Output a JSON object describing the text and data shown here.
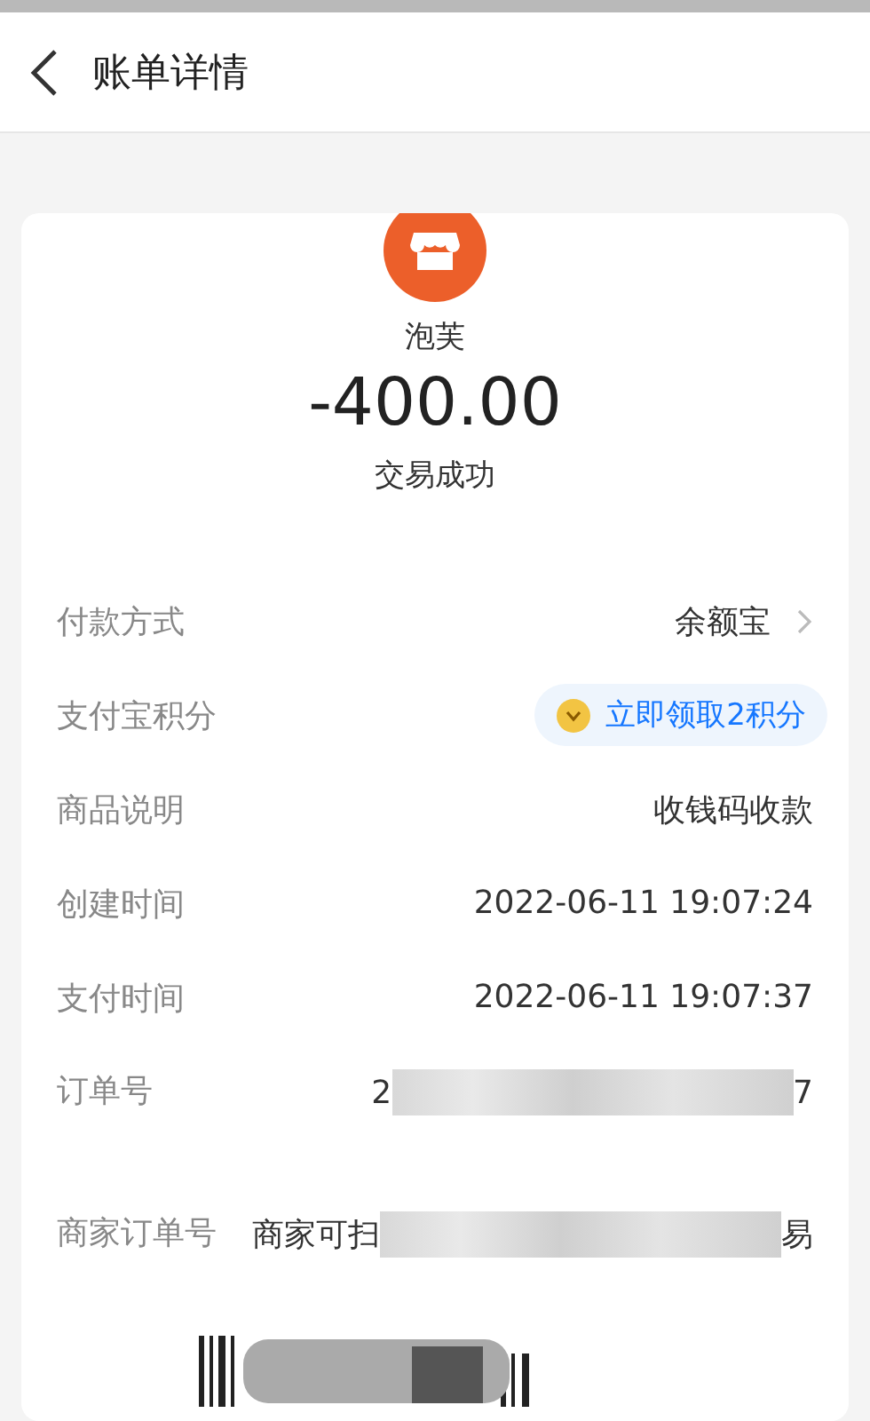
{
  "header": {
    "title": "账单详情"
  },
  "summary": {
    "merchant": "泡芙",
    "amount": "-400.00",
    "status": "交易成功"
  },
  "details": [
    {
      "kind": "link",
      "label": "付款方式",
      "value": "余额宝"
    },
    {
      "kind": "badge",
      "label": "支付宝积分",
      "value": "立即领取2积分"
    },
    {
      "kind": "plain",
      "label": "商品说明",
      "value": "收钱码收款"
    },
    {
      "kind": "plain",
      "label": "创建时间",
      "value": "2022-06-11 19:07:24"
    },
    {
      "kind": "plain",
      "label": "支付时间",
      "value": "2022-06-11 19:07:37"
    },
    {
      "kind": "blurred",
      "label": "订单号",
      "value_start": "2",
      "value_end": "7"
    },
    {
      "kind": "blurred",
      "label": "商家订单号",
      "value_start": "商家可扫",
      "value_end": "易"
    }
  ]
}
